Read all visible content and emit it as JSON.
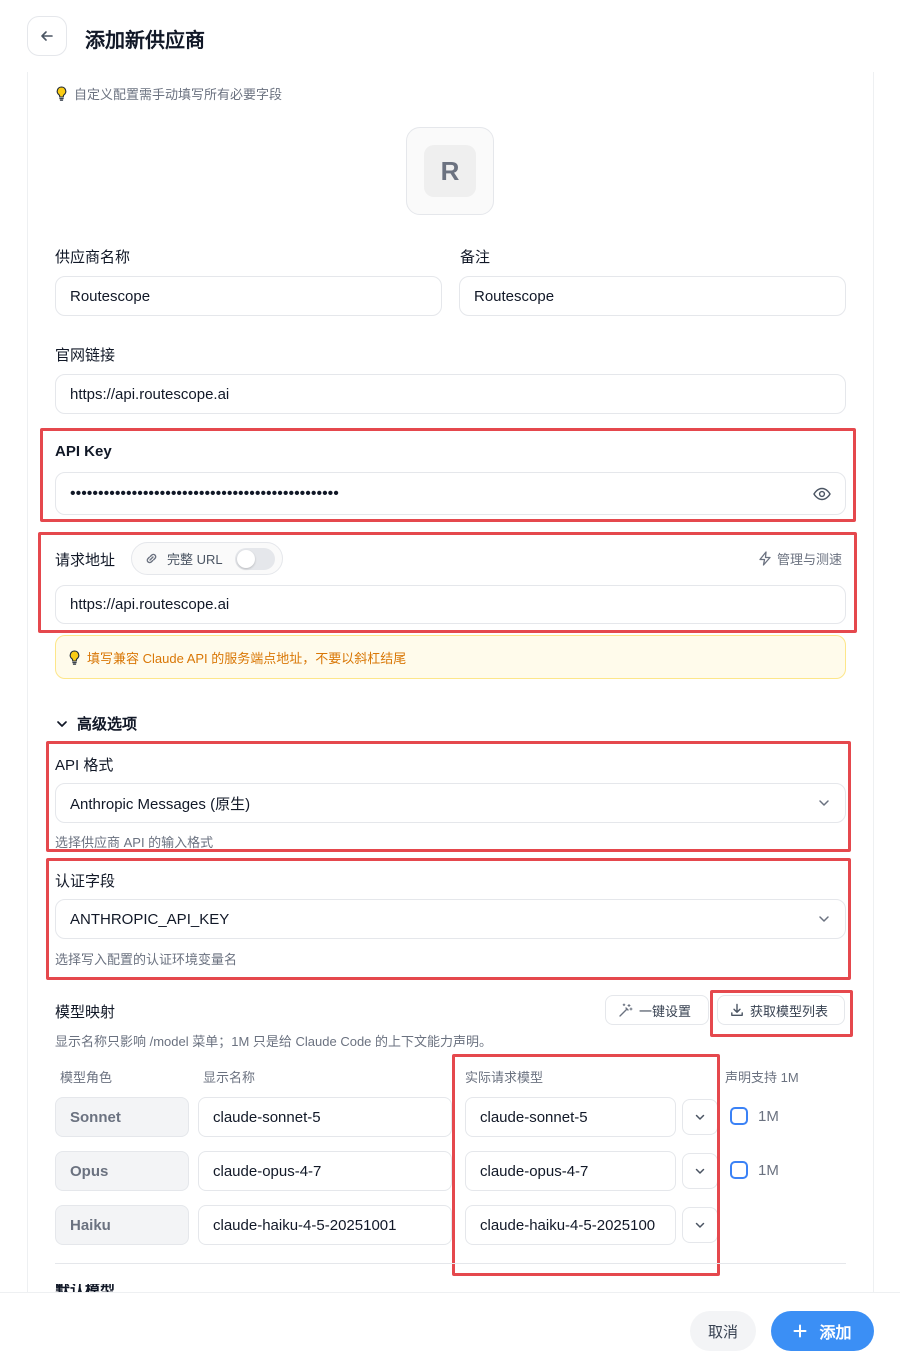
{
  "header": {
    "title": "添加新供应商"
  },
  "hint_top": "自定义配置需手动填写所有必要字段",
  "logo": {
    "letter": "R"
  },
  "fields": {
    "name": {
      "label": "供应商名称",
      "value": "Routescope"
    },
    "note": {
      "label": "备注",
      "value": "Routescope"
    },
    "website": {
      "label": "官网链接",
      "value": "https://api.routescope.ai"
    },
    "api_key": {
      "label": "API Key",
      "value": "••••••••••••••••••••••••••••••••••••••••••••••••"
    },
    "endpoint": {
      "label": "请求地址",
      "full_url_label": "完整 URL",
      "full_url_enabled": false,
      "manage_label": "管理与测速",
      "value": "https://api.routescope.ai"
    }
  },
  "warning": "填写兼容 Claude API 的服务端点地址，不要以斜杠结尾",
  "advanced": {
    "toggle_label": "高级选项",
    "api_format": {
      "label": "API 格式",
      "value": "Anthropic Messages (原生)",
      "help": "选择供应商 API 的输入格式"
    },
    "auth_field": {
      "label": "认证字段",
      "value": "ANTHROPIC_API_KEY",
      "help": "选择写入配置的认证环境变量名"
    }
  },
  "model_mapping": {
    "title": "模型映射",
    "description": "显示名称只影响 /model 菜单；1M 只是给 Claude Code 的上下文能力声明。",
    "one_click_label": "一键设置",
    "fetch_label": "获取模型列表",
    "columns": {
      "role": "模型角色",
      "display": "显示名称",
      "actual": "实际请求模型",
      "support_1m": "声明支持 1M"
    },
    "rows": [
      {
        "role": "Sonnet",
        "display": "claude-sonnet-5",
        "actual": "claude-sonnet-5",
        "one_m_label": "1M",
        "one_m_checked": false
      },
      {
        "role": "Opus",
        "display": "claude-opus-4-7",
        "actual": "claude-opus-4-7",
        "one_m_label": "1M",
        "one_m_checked": false
      },
      {
        "role": "Haiku",
        "display": "claude-haiku-4-5-20251001",
        "actual": "claude-haiku-4-5-2025100"
      }
    ]
  },
  "next_section_title": "默认模型",
  "footer": {
    "cancel_label": "取消",
    "add_label": "添加"
  },
  "colors": {
    "accent": "#3b8ff5",
    "highlight": "#e5484d",
    "warning_text": "#d97706"
  }
}
